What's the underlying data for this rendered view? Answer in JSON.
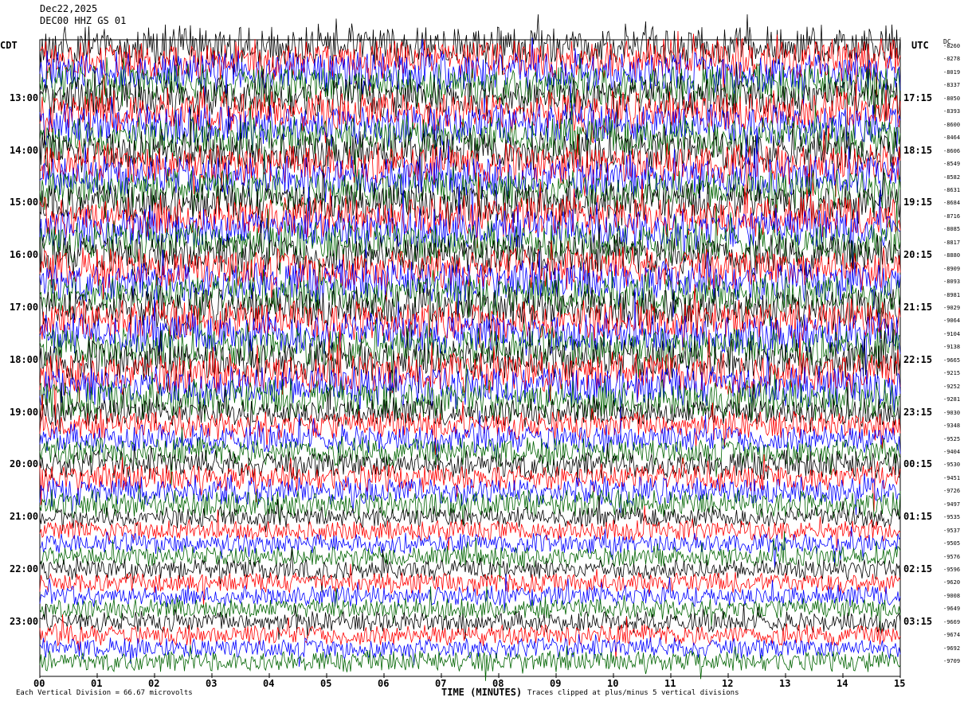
{
  "header": {
    "date": "Dec22,2025",
    "station": "DEC00 HHZ GS 01"
  },
  "left_axis_title": "CDT",
  "right_axis_title": "UTC",
  "dc_title": "DC",
  "chart_data": {
    "type": "helicorder",
    "xlabel": "TIME (MINUTES)",
    "xlim": [
      0,
      15
    ],
    "x_ticks": [
      "00",
      "01",
      "02",
      "03",
      "04",
      "05",
      "06",
      "07",
      "08",
      "09",
      "10",
      "11",
      "12",
      "13",
      "14",
      "15"
    ],
    "left_hour_labels": [
      "13:00",
      "14:00",
      "15:00",
      "16:00",
      "17:00",
      "18:00",
      "19:00",
      "20:00",
      "21:00",
      "22:00",
      "23:00"
    ],
    "right_hour_labels": [
      "17:15",
      "18:15",
      "19:15",
      "20:15",
      "21:15",
      "22:15",
      "23:15",
      "00:15",
      "01:15",
      "02:15",
      "03:15"
    ],
    "traces_per_hour": 4,
    "trace_colors": [
      "#000000",
      "#ff0000",
      "#0000ff",
      "#006400"
    ],
    "dc_offsets": [
      "-8260",
      "-8278",
      "-8019",
      "-8337",
      "-8050",
      "-8393",
      "-8600",
      "-8464",
      "-8606",
      "-8549",
      "-8582",
      "-8631",
      "-8684",
      "-8716",
      "-8085",
      "-8817",
      "-8880",
      "-8909",
      "-8093",
      "-8981",
      "-9029",
      "-9064",
      "-9104",
      "-9138",
      "-9665",
      "-9215",
      "-9252",
      "-9281",
      "-9030",
      "-9348",
      "-9525",
      "-9404",
      "-9530",
      "-9451",
      "-9726",
      "-9497",
      "-9535",
      "-9537",
      "-9505",
      "-9576",
      "-9596",
      "-9620",
      "-9008",
      "-9649",
      "-9669",
      "-9674",
      "-9692",
      "-9709"
    ],
    "vertical_division": "66.67 microvolts",
    "footer_left": "Each Vertical Division =",
    "footer_value": "66.67 microvolts",
    "footer_right": "Traces clipped at plus/minus 5 vertical divisions"
  }
}
